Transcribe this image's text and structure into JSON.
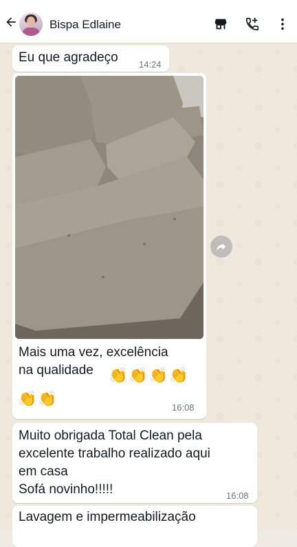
{
  "header": {
    "contact_name": "Bispa Edlaine"
  },
  "icons": {
    "back": "arrow-left-icon",
    "store": "storefront-icon",
    "call": "add-call-icon",
    "menu": "more-vertical-icon",
    "forward": "forward-icon"
  },
  "messages": [
    {
      "text": "Eu que agradeço",
      "time": "14:24"
    },
    {
      "caption": "Mais uma vez, excelência\nna qualidade",
      "emoji_line1": "👏👏👏👏",
      "emoji_line2": "👏👏",
      "time": "16:08"
    },
    {
      "text": "Muito obrigada Total Clean pela\nexcelente trabalho realizado aqui\nem casa\nSofá novinho!!!!!",
      "time": "16:08"
    },
    {
      "text": "Lavagem e impermeabilização"
    }
  ],
  "colors": {
    "bubble": "#ffffff",
    "chat_background": "#efe8dd",
    "timestamp": "#667781"
  }
}
